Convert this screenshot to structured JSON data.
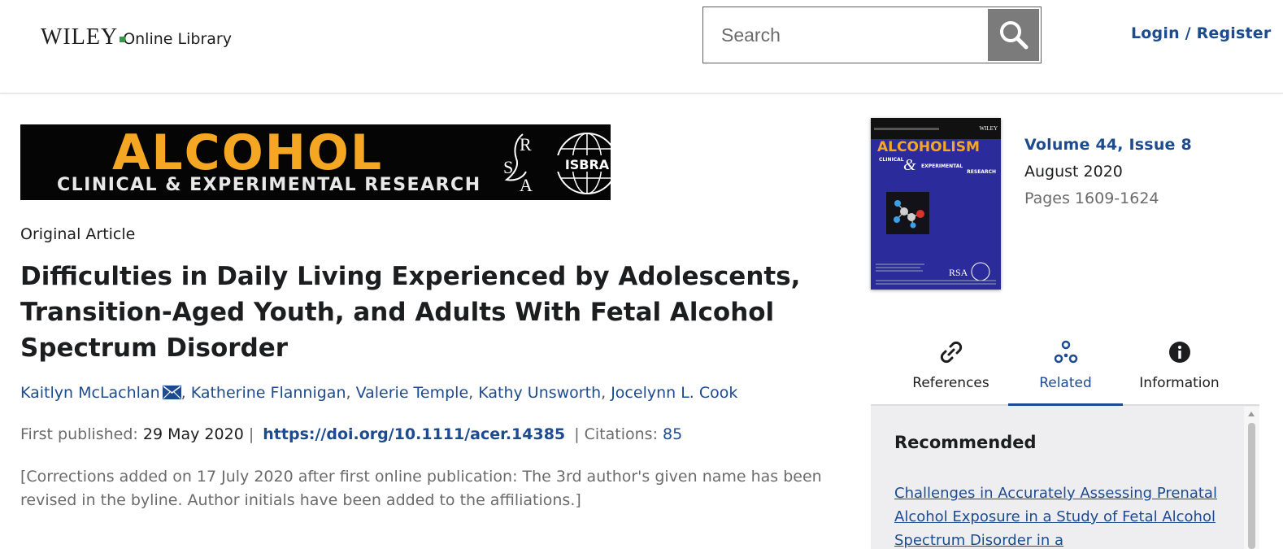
{
  "header": {
    "logo_wordmark": "WILEY",
    "logo_product": "Online Library",
    "search_placeholder": "Search",
    "login_label": "Login / Register"
  },
  "banner": {
    "title": "ALCOHOL",
    "subtitle": "CLINICAL & EXPERIMENTAL RESEARCH",
    "rsa_mark": "RSA",
    "isbra_mark": "ISBRA"
  },
  "article": {
    "type": "Original Article",
    "title": "Difficulties in Daily Living Experienced by Adolescents, Transition-Aged Youth, and Adults With Fetal Alcohol Spectrum Disorder",
    "authors": [
      "Kaitlyn McLachlan",
      "Katherine Flannigan",
      "Valerie Temple",
      "Kathy Unsworth",
      "Jocelynn L. Cook"
    ],
    "first_published_label": "First published:",
    "first_published_date": "29 May 2020",
    "doi": "https://doi.org/10.1111/acer.14385",
    "citations_label": "Citations:",
    "citations_count": "85",
    "corrections": "[Corrections added on 17 July 2020 after first online publication: The 3rd author's given name has been revised in the byline. Author initials have been added to the affiliations.]"
  },
  "issue": {
    "cover_title": "ALCOHOLISM",
    "cover_subtitle_1": "CLINICAL",
    "cover_subtitle_2": "EXPERIMENTAL",
    "cover_subtitle_3": "RESEARCH",
    "cover_brand": "WILEY",
    "volume": "Volume 44, Issue 8",
    "month": "August 2020",
    "pages": "Pages 1609-1624"
  },
  "side_tabs": [
    {
      "label": "References",
      "icon": "link-icon",
      "active": false
    },
    {
      "label": "Related",
      "icon": "related-icon",
      "active": true
    },
    {
      "label": "Information",
      "icon": "info-icon",
      "active": false
    }
  ],
  "recommended": {
    "heading": "Recommended",
    "first_link": "Challenges in Accurately Assessing Prenatal Alcohol Exposure in a Study of Fetal Alcohol Spectrum Disorder in a"
  },
  "colors": {
    "link_blue": "#1d4b8f",
    "banner_orange": "#f5a623",
    "cover_blue": "#2b2b9c",
    "panel_bg": "#eeeef0"
  }
}
